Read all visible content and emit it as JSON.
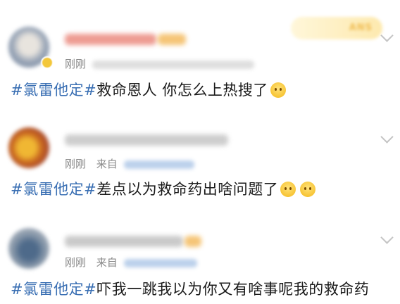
{
  "posts": [
    {
      "time": "刚刚",
      "source_prefix": "",
      "hashtag": "#氯雷他定#",
      "text": "救命恩人 你怎么上热搜了",
      "emoji": "hug-emoji"
    },
    {
      "time": "刚刚",
      "source_prefix": "来自",
      "hashtag": "#氯雷他定#",
      "text": "差点以为救命药出啥问题了",
      "emoji": "smile-emoji"
    },
    {
      "time": "刚刚",
      "source_prefix": "来自",
      "hashtag": "#氯雷他定#",
      "text": "吓我一跳我以为你又有啥事呢我的救命药",
      "emoji": ""
    }
  ],
  "fan_badge": "ANS",
  "colors": {
    "hashtag": "#3a6fb3",
    "meta": "#8a8a8a",
    "text": "#1a1a1a"
  }
}
